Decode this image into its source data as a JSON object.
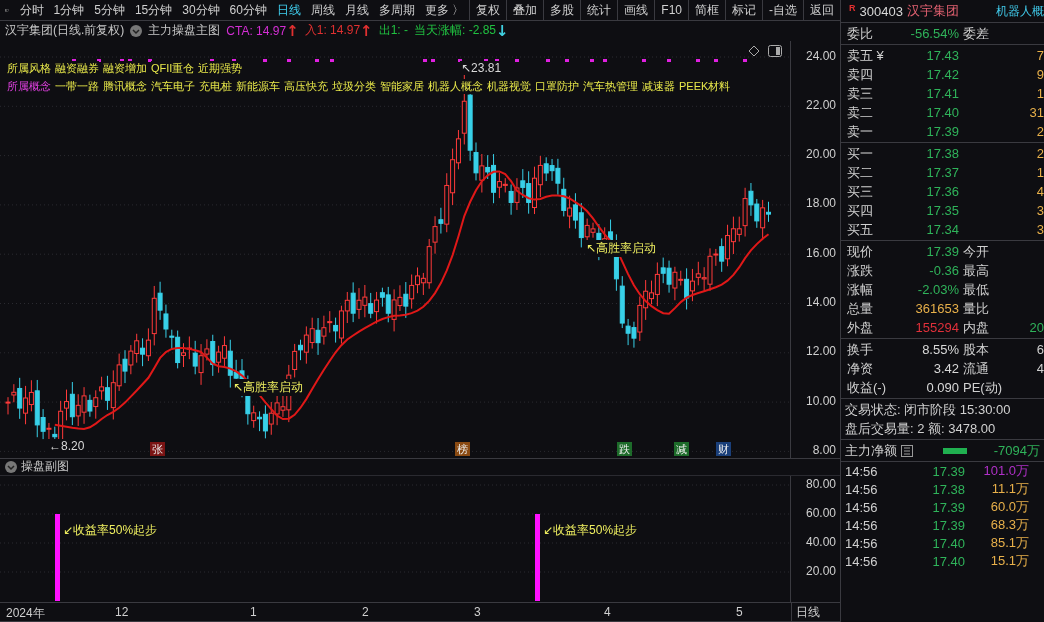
{
  "toolbar": {
    "periods": [
      {
        "label": "分时",
        "selected": false
      },
      {
        "label": "1分钟",
        "selected": false
      },
      {
        "label": "5分钟",
        "selected": false
      },
      {
        "label": "15分钟",
        "selected": false
      },
      {
        "label": "30分钟",
        "selected": false
      },
      {
        "label": "60分钟",
        "selected": false
      },
      {
        "label": "日线",
        "selected": true
      },
      {
        "label": "周线",
        "selected": false
      },
      {
        "label": "月线",
        "selected": false
      },
      {
        "label": "多周期",
        "selected": false
      },
      {
        "label": "更多 〉",
        "selected": false
      }
    ],
    "actions": [
      "复权",
      "叠加",
      "多股",
      "统计",
      "画线",
      "F10",
      "简框",
      "标记",
      "-自选",
      "返回"
    ]
  },
  "chart_header": {
    "title": "汉宇集团(日线.前复权)",
    "indicator": "主力操盘主图",
    "readouts": [
      {
        "text": "CTA: 14.97",
        "arrow": {
          "text": "↑",
          "color": "#e03030"
        },
        "color": "#d42ed4"
      },
      {
        "text": "入1: 14.97",
        "arrow": {
          "text": "↑",
          "color": "#e03030"
        },
        "color": "#e03030"
      },
      {
        "text": "出1: -",
        "color": "#20c040"
      },
      {
        "text": "当天涨幅: -2.85",
        "arrow": {
          "text": "↓",
          "color": "#40d0e0"
        },
        "color": "#20c040"
      }
    ]
  },
  "style_tags": {
    "label": "所属风格",
    "items": [
      "融资融券",
      "融资增加",
      "QFII重仓",
      "近期强势"
    ]
  },
  "concept_tags": {
    "label": "所属概念",
    "items": [
      "一带一路",
      "腾讯概念",
      "汽车电子",
      "充电桩",
      "新能源车",
      "高压快充",
      "垃圾分类",
      "智能家居",
      "机器人概念",
      "机器视觉",
      "口罩防护",
      "汽车热管理",
      "减速器",
      "PEEK材料"
    ]
  },
  "price_axis": [
    "24.00",
    "22.00",
    "20.00",
    "18.00",
    "16.00",
    "14.00",
    "12.00",
    "10.00",
    "8.00"
  ],
  "chart_notes": {
    "high": "↖23.81",
    "low": "←8.20",
    "signals": [
      "↖高胜率启动",
      "↖高胜率启动"
    ]
  },
  "event_markers": [
    {
      "label": "张",
      "color": "#7a1414"
    },
    {
      "label": "榜",
      "color": "#8a4a12"
    },
    {
      "label": "跌",
      "color": "#1d6b2a"
    },
    {
      "label": "减",
      "color": "#1d6b2a"
    },
    {
      "label": "财",
      "color": "#1a3f7a"
    }
  ],
  "sub_chart": {
    "title": "操盘副图",
    "axis": [
      "80.00",
      "60.00",
      "40.00",
      "20.00"
    ],
    "signals": [
      "↙收益率50%起步",
      "↙收益率50%起步"
    ]
  },
  "date_axis": {
    "labels": [
      "2024年",
      "12",
      "1",
      "2",
      "3",
      "4",
      "5"
    ],
    "period": "日线"
  },
  "quote": {
    "badge": "R",
    "code": "300403",
    "name": "汉宇集团",
    "concept": "机器人概",
    "ratio": {
      "label": "委比",
      "value": "-56.54%",
      "label2": "委差"
    },
    "asks": [
      {
        "label": "卖五 ¥",
        "price": "17.43",
        "volume": "7"
      },
      {
        "label": "卖四",
        "price": "17.42",
        "volume": "9"
      },
      {
        "label": "卖三",
        "price": "17.41",
        "volume": "1"
      },
      {
        "label": "卖二",
        "price": "17.40",
        "volume": "31"
      },
      {
        "label": "卖一",
        "price": "17.39",
        "volume": "2"
      }
    ],
    "bids": [
      {
        "label": "买一",
        "price": "17.38",
        "volume": "2"
      },
      {
        "label": "买二",
        "price": "17.37",
        "volume": "1"
      },
      {
        "label": "买三",
        "price": "17.36",
        "volume": "4"
      },
      {
        "label": "买四",
        "price": "17.35",
        "volume": "3"
      },
      {
        "label": "买五",
        "price": "17.34",
        "volume": "3"
      }
    ],
    "stats": [
      {
        "label": "现价",
        "value": "17.39",
        "color": "#2fb35a",
        "label2": "今开"
      },
      {
        "label": "涨跌",
        "value": "-0.36",
        "color": "#2fb35a",
        "label2": "最高"
      },
      {
        "label": "涨幅",
        "value": "-2.03%",
        "color": "#2fb35a",
        "label2": "最低"
      },
      {
        "label": "总量",
        "value": "361653",
        "color": "#e8b04a",
        "label2": "量比"
      },
      {
        "label": "外盘",
        "value": "155294",
        "color": "#e0303a",
        "label2": "内盘",
        "value2": "20"
      }
    ],
    "stats2": [
      {
        "label": "换手",
        "value": "8.55%",
        "color": "#d8d8d8",
        "label2": "股本",
        "value2": "6"
      },
      {
        "label": "净资",
        "value": "3.42",
        "color": "#d8d8d8",
        "label2": "流通",
        "value2": "4"
      },
      {
        "label": "收益(-)",
        "value": "0.090",
        "color": "#d8d8d8",
        "label2": "PE(动)"
      }
    ],
    "status": [
      "交易状态: 闭市阶段 15:30:00",
      "盘后交易量: 2  额: 3478.00"
    ],
    "main_flow": {
      "label": "主力净额",
      "value": "-7094万"
    },
    "ticks": [
      {
        "time": "14:56",
        "price": "17.39",
        "volume": "101.0万",
        "color": "#b030c8"
      },
      {
        "time": "14:56",
        "price": "17.38",
        "volume": "11.1万",
        "color": "#e8b04a"
      },
      {
        "time": "14:56",
        "price": "17.39",
        "volume": "60.0万",
        "color": "#e8b04a"
      },
      {
        "time": "14:56",
        "price": "17.39",
        "volume": "68.3万",
        "color": "#e8b04a"
      },
      {
        "time": "14:56",
        "price": "17.40",
        "volume": "85.1万",
        "color": "#e8b04a"
      },
      {
        "time": "14:56",
        "price": "17.40",
        "volume": "15.1万",
        "color": "#e8b04a"
      }
    ]
  }
}
